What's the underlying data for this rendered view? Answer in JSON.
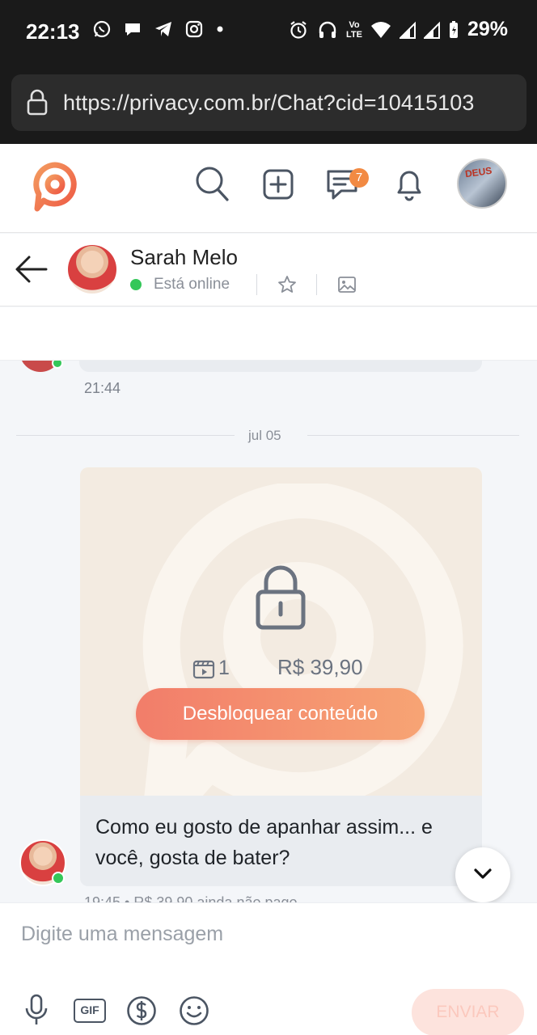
{
  "status_bar": {
    "time": "22:13",
    "lte_top": "Vo",
    "lte_bottom": "LTE",
    "battery_percent": "29%"
  },
  "browser": {
    "url": "https://privacy.com.br/Chat?cid=10415103"
  },
  "app_header": {
    "messages_badge": "7",
    "avatar_text": "DEUS"
  },
  "chat_header": {
    "contact_name": "Sarah Melo",
    "status": "Está online"
  },
  "chat": {
    "previous_message_time": "21:44",
    "date_divider": "jul 05",
    "locked_content": {
      "media_count": "1",
      "price": "R$ 39,90",
      "unlock_label": "Desbloquear conteúdo"
    },
    "message_text": "Como eu gosto de apanhar assim... e você, gosta de bater?",
    "message_meta": "19:45 • R$ 39,90 ainda não pago"
  },
  "composer": {
    "placeholder": "Digite uma mensagem",
    "gif_label": "GIF",
    "send_label": "ENVIAR"
  },
  "colors": {
    "accent": "#f27d6a",
    "online": "#34c759",
    "badge": "#f28a43"
  }
}
